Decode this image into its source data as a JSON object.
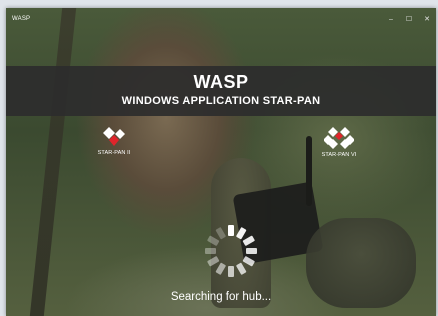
{
  "window": {
    "title": "WASP",
    "controls": {
      "minimize_icon": "–",
      "maximize_icon": "☐",
      "close_icon": "✕"
    }
  },
  "banner": {
    "app_name": "WASP",
    "subtitle": "WINDOWS APPLICATION STAR-PAN"
  },
  "devices": [
    {
      "label": "STAR-PAN II",
      "icon": "diamond-logo-icon"
    },
    {
      "label": "STAR-PAN VI",
      "icon": "diamond-cluster-logo-icon"
    }
  ],
  "status": {
    "text": "Searching for hub..."
  },
  "colors": {
    "banner_bg": "#2d2d2d",
    "accent_red": "#e0242b",
    "text": "#ffffff"
  }
}
